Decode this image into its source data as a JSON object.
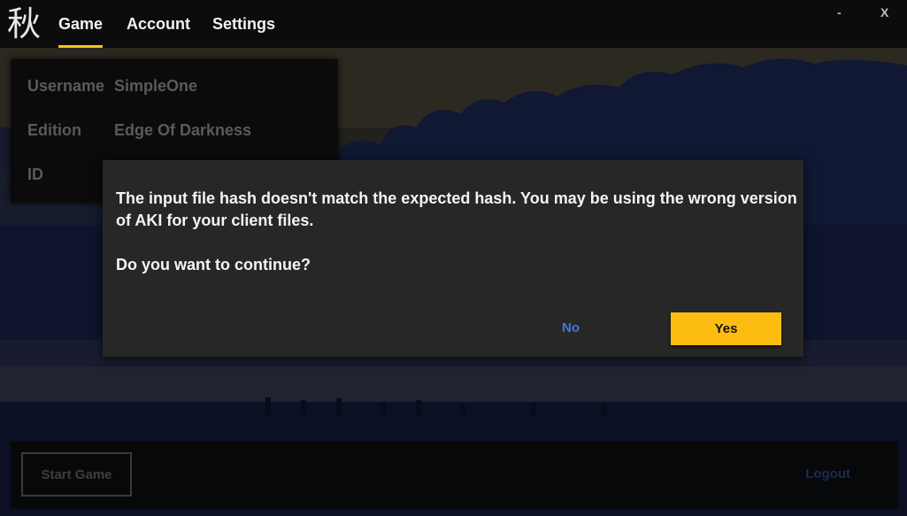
{
  "app": {
    "logo_glyph": "秋",
    "minimize_label": "-",
    "close_label": "X"
  },
  "nav": {
    "tabs": [
      {
        "label": "Game",
        "active": true
      },
      {
        "label": "Account",
        "active": false
      },
      {
        "label": "Settings",
        "active": false
      }
    ]
  },
  "profile": {
    "username_label": "Username",
    "username_value": "SimpleOne",
    "edition_label": "Edition",
    "edition_value": "Edge Of Darkness",
    "id_label": "ID"
  },
  "footer": {
    "start_game_label": "Start Game",
    "logout_label": "Logout"
  },
  "dialog": {
    "message": "The input file hash doesn't match the expected hash. You may be using the wrong version of AKI for your client files.",
    "question": "Do you want to continue?",
    "no_label": "No",
    "yes_label": "Yes"
  },
  "colors": {
    "accent": "#fcbd10",
    "link": "#4a73e0",
    "dialog_bg": "#272727"
  }
}
